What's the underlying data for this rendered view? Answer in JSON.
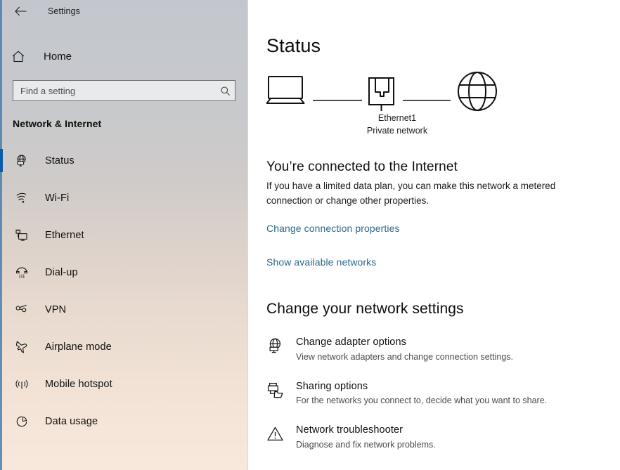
{
  "window": {
    "title": "Settings",
    "back_icon": "back-arrow-icon"
  },
  "sidebar": {
    "home_label": "Home",
    "home_icon": "home-icon",
    "search": {
      "placeholder": "Find a setting",
      "value": "",
      "icon": "search-icon"
    },
    "section_title": "Network & Internet",
    "accent_color": "#0a5ca8",
    "items": [
      {
        "label": "Status",
        "icon": "globe-monitor-icon",
        "selected": true
      },
      {
        "label": "Wi-Fi",
        "icon": "wifi-icon",
        "selected": false
      },
      {
        "label": "Ethernet",
        "icon": "ethernet-icon",
        "selected": false
      },
      {
        "label": "Dial-up",
        "icon": "dialup-phone-icon",
        "selected": false
      },
      {
        "label": "VPN",
        "icon": "vpn-key-icon",
        "selected": false
      },
      {
        "label": "Airplane mode",
        "icon": "airplane-icon",
        "selected": false
      },
      {
        "label": "Mobile hotspot",
        "icon": "hotspot-icon",
        "selected": false
      },
      {
        "label": "Data usage",
        "icon": "pie-chart-icon",
        "selected": false
      }
    ]
  },
  "main": {
    "page_title": "Status",
    "diagram": {
      "device_icon": "laptop-icon",
      "adapter_icon": "ethernet-port-icon",
      "internet_icon": "globe-icon",
      "adapter_name": "Ethernet1",
      "adapter_type": "Private network"
    },
    "connection": {
      "title": "You’re connected to the Internet",
      "description": "If you have a limited data plan, you can make this network a metered connection or change other properties.",
      "link_properties": "Change connection properties",
      "link_networks": "Show available networks",
      "link_color": "#2a6a8c"
    },
    "settings_section": {
      "heading": "Change your network settings",
      "options": [
        {
          "title": "Change adapter options",
          "subtitle": "View network adapters and change connection settings.",
          "icon": "globe-adapter-icon"
        },
        {
          "title": "Sharing options",
          "subtitle": "For the networks you connect to, decide what you want to share.",
          "icon": "printer-folder-icon"
        },
        {
          "title": "Network troubleshooter",
          "subtitle": "Diagnose and fix network problems.",
          "icon": "warning-triangle-icon"
        }
      ]
    }
  }
}
